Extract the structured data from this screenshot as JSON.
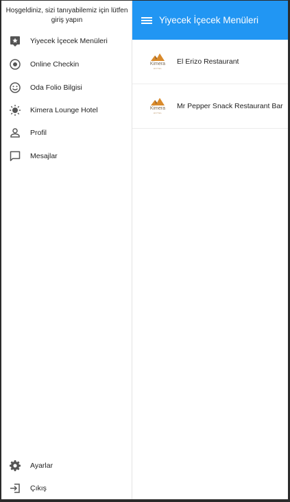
{
  "drawer": {
    "header_text": "Hoşgeldiniz, sizi tanıyabilemiz için lütfen giriş yapın",
    "items": [
      {
        "label": "Yiyecek İçecek Menüleri",
        "icon": "restaurant-menu-icon"
      },
      {
        "label": "Online Checkin",
        "icon": "radio-target-icon"
      },
      {
        "label": "Oda Folio Bilgisi",
        "icon": "smiley-icon"
      },
      {
        "label": "Kimera Lounge Hotel",
        "icon": "sun-icon"
      },
      {
        "label": "Profil",
        "icon": "person-icon"
      },
      {
        "label": "Mesajlar",
        "icon": "chat-bubble-icon"
      }
    ],
    "bottom_items": [
      {
        "label": "Ayarlar",
        "icon": "gear-icon"
      },
      {
        "label": "Çıkış",
        "icon": "logout-icon"
      }
    ]
  },
  "appbar": {
    "title": "Yiyecek İçecek Menüleri",
    "color": "#2196f3"
  },
  "restaurants": [
    {
      "name": "El Erizo Restaurant",
      "logo_text": "Kimera",
      "logo_sub": "HOTEL"
    },
    {
      "name": "Mr Pepper Snack Restaurant Bar",
      "logo_text": "Kimera",
      "logo_sub": "HOTEL"
    }
  ]
}
